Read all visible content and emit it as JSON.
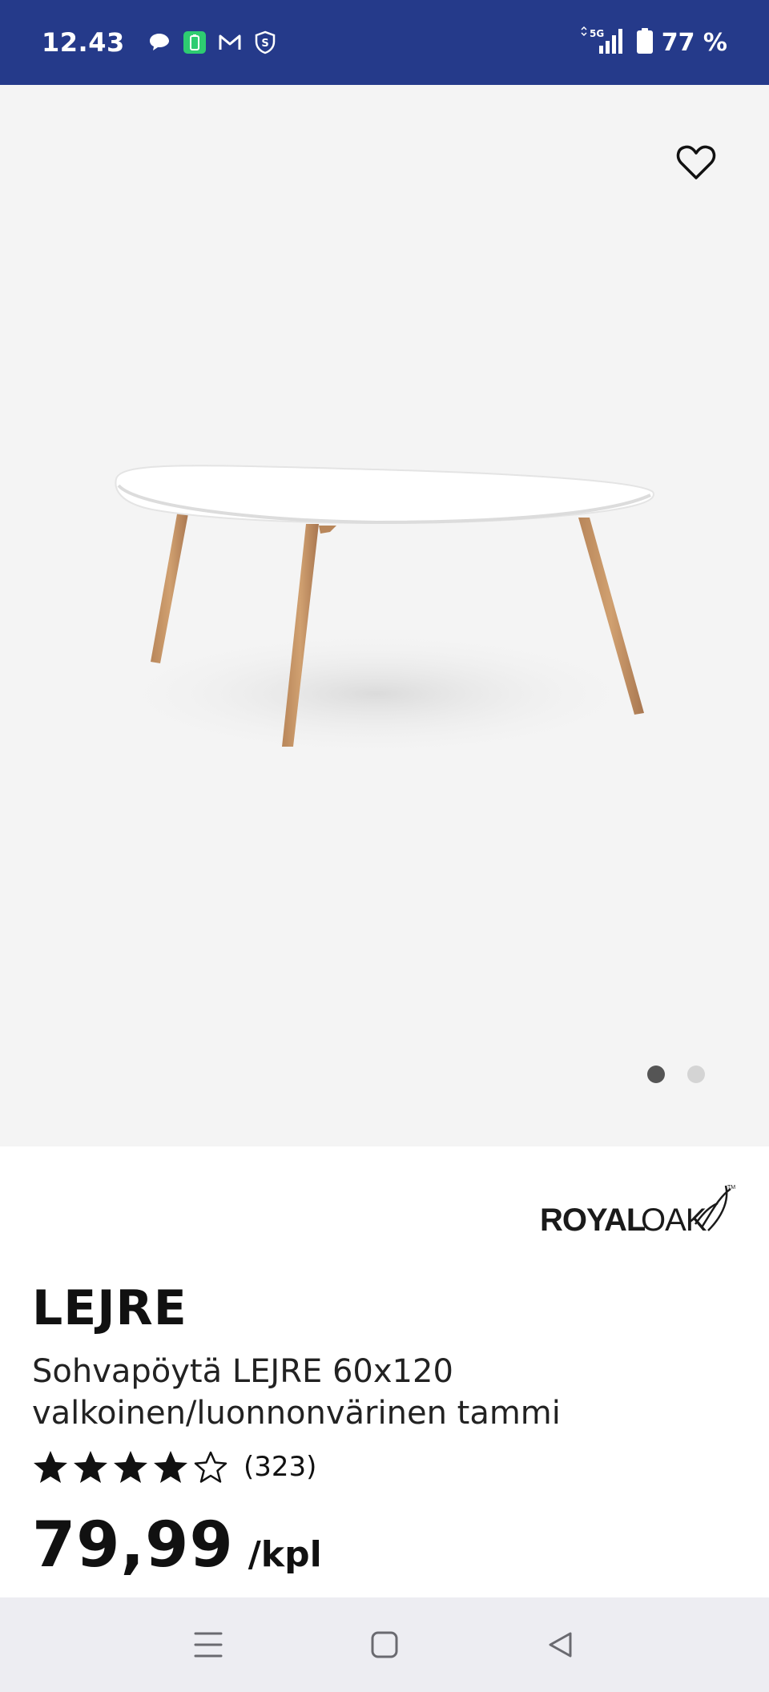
{
  "status_bar": {
    "time": "12.43",
    "network": "5G",
    "battery_percent": "77 %",
    "icons": [
      "chat-icon",
      "battery-saver-icon",
      "gmail-icon",
      "shield-icon",
      "signal-icon",
      "battery-icon"
    ]
  },
  "gallery": {
    "total_images": 2,
    "active_index": 0,
    "favorite_icon": "heart-outline-icon"
  },
  "product": {
    "brand_logo": "ROYALOAK",
    "title": "LEJRE",
    "subtitle": "Sohvapöytä LEJRE 60x120 valkoinen/luonnonvärinen tammi",
    "rating_value": 4,
    "rating_max": 5,
    "rating_count": "(323)",
    "price": "79,99",
    "unit": "/kpl"
  },
  "colors": {
    "status_bar": "#253a8a",
    "image_background": "#f4f4f4",
    "nav_bar": "#ededf2",
    "text": "#111111"
  },
  "nav": {
    "icons": [
      "menu-icon",
      "home-icon",
      "back-icon"
    ]
  }
}
